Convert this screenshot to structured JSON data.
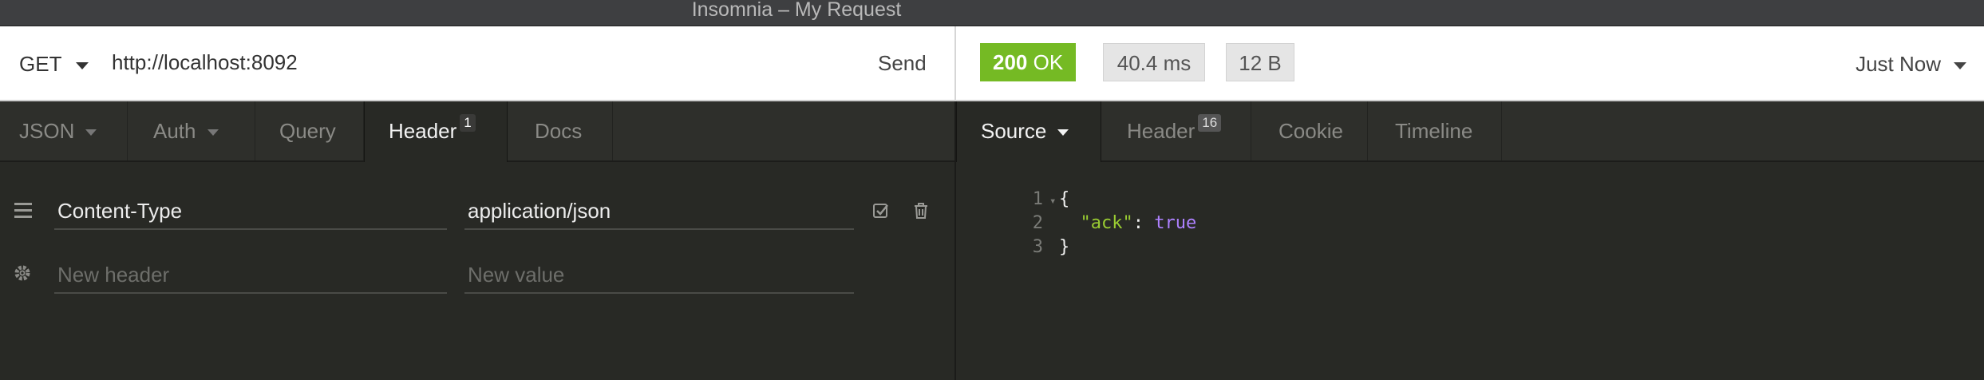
{
  "window": {
    "title": "Insomnia – My Request"
  },
  "request": {
    "method": "GET",
    "url": "http://localhost:8092",
    "send_label": "Send",
    "tabs": [
      {
        "label": "JSON"
      },
      {
        "label": "Auth"
      },
      {
        "label": "Query"
      },
      {
        "label": "Header",
        "count": "1"
      },
      {
        "label": "Docs"
      }
    ],
    "headers": [
      {
        "name": "Content-Type",
        "value": "application/json"
      }
    ],
    "new_header_placeholder": "New header",
    "new_value_placeholder": "New value"
  },
  "response": {
    "status_code": "200",
    "status_text": "OK",
    "time": "40.4 ms",
    "size": "12 B",
    "when": "Just Now",
    "tabs": [
      {
        "label": "Source"
      },
      {
        "label": "Header",
        "count": "16"
      },
      {
        "label": "Cookie"
      },
      {
        "label": "Timeline"
      }
    ],
    "body_lines": [
      {
        "num": "1",
        "text": "{"
      },
      {
        "num": "2",
        "key": "\"ack\"",
        "value": "true"
      },
      {
        "num": "3",
        "text": "}"
      }
    ]
  },
  "colors": {
    "status_ok": "#75ba24",
    "background": "#282925",
    "json_key": "#9acd32",
    "json_bool": "#ae81ff"
  },
  "icons": {
    "method_dropdown": "chevron-down-icon",
    "drag_handle": "drag-handle-icon",
    "settings": "gear-icon",
    "enable": "checkbox-icon",
    "delete": "trash-icon"
  }
}
